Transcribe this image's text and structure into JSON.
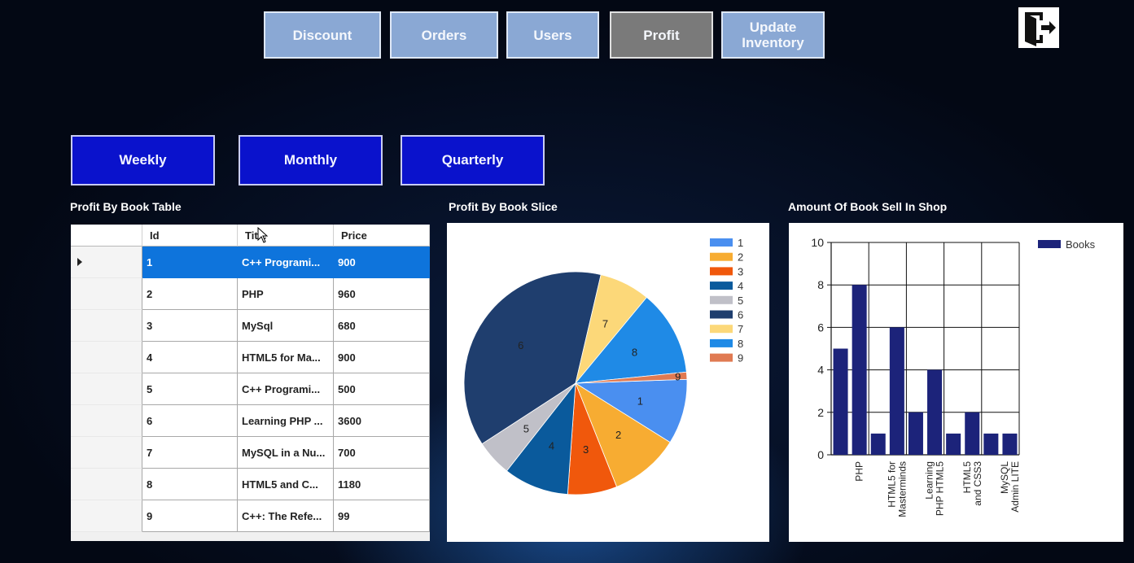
{
  "nav": {
    "discount": "Discount",
    "orders": "Orders",
    "users": "Users",
    "profit": "Profit",
    "update_inventory_line1": "Update",
    "update_inventory_line2": "Inventory"
  },
  "period": {
    "weekly": "Weekly",
    "monthly": "Monthly",
    "quarterly": "Quarterly"
  },
  "sections": {
    "table_title": "Profit By Book Table",
    "pie_title": "Profit By Book Slice",
    "bar_title": "Amount Of Book Sell In Shop"
  },
  "table": {
    "columns": [
      "Id",
      "Title",
      "Price"
    ],
    "rows": [
      {
        "id": "1",
        "title": "C++ Programi...",
        "price": "900"
      },
      {
        "id": "2",
        "title": "PHP",
        "price": "960"
      },
      {
        "id": "3",
        "title": "MySql",
        "price": "680"
      },
      {
        "id": "4",
        "title": "HTML5 for Ma...",
        "price": "900"
      },
      {
        "id": "5",
        "title": "C++ Programi...",
        "price": "500"
      },
      {
        "id": "6",
        "title": "Learning PHP ...",
        "price": "3600"
      },
      {
        "id": "7",
        "title": "MySQL in a Nu...",
        "price": "700"
      },
      {
        "id": "8",
        "title": "HTML5 and C...",
        "price": "1180"
      },
      {
        "id": "9",
        "title": "C++: The Refe...",
        "price": "99"
      }
    ]
  },
  "chart_data": [
    {
      "type": "pie",
      "title": "Profit By Book Slice",
      "categories": [
        "1",
        "2",
        "3",
        "4",
        "5",
        "6",
        "7",
        "8",
        "9"
      ],
      "values": [
        900,
        960,
        680,
        900,
        500,
        3600,
        700,
        1180,
        99
      ],
      "colors": [
        "#4a8ff0",
        "#f7ac32",
        "#f0580c",
        "#0a5a9c",
        "#c0c0c8",
        "#1f3e6e",
        "#fcd879",
        "#1f8ae6",
        "#e07a52"
      ],
      "legend": "top-right"
    },
    {
      "type": "bar",
      "title": "Amount Of Book Sell In Shop",
      "series": [
        {
          "name": "Books",
          "values": [
            5,
            8,
            1,
            6,
            2,
            4,
            1,
            2,
            1,
            1
          ]
        }
      ],
      "tick_labels": [
        "PHP",
        "HTML5 for Masterminds",
        "Learning PHP HTML5",
        "HTML5 and CSS3",
        "MySQL Admin LITE"
      ],
      "ylim": [
        0,
        10
      ],
      "yticks": [
        0,
        2,
        4,
        6,
        8,
        10
      ],
      "color": "#1c237a",
      "grid": true,
      "legend": "top-right"
    }
  ]
}
